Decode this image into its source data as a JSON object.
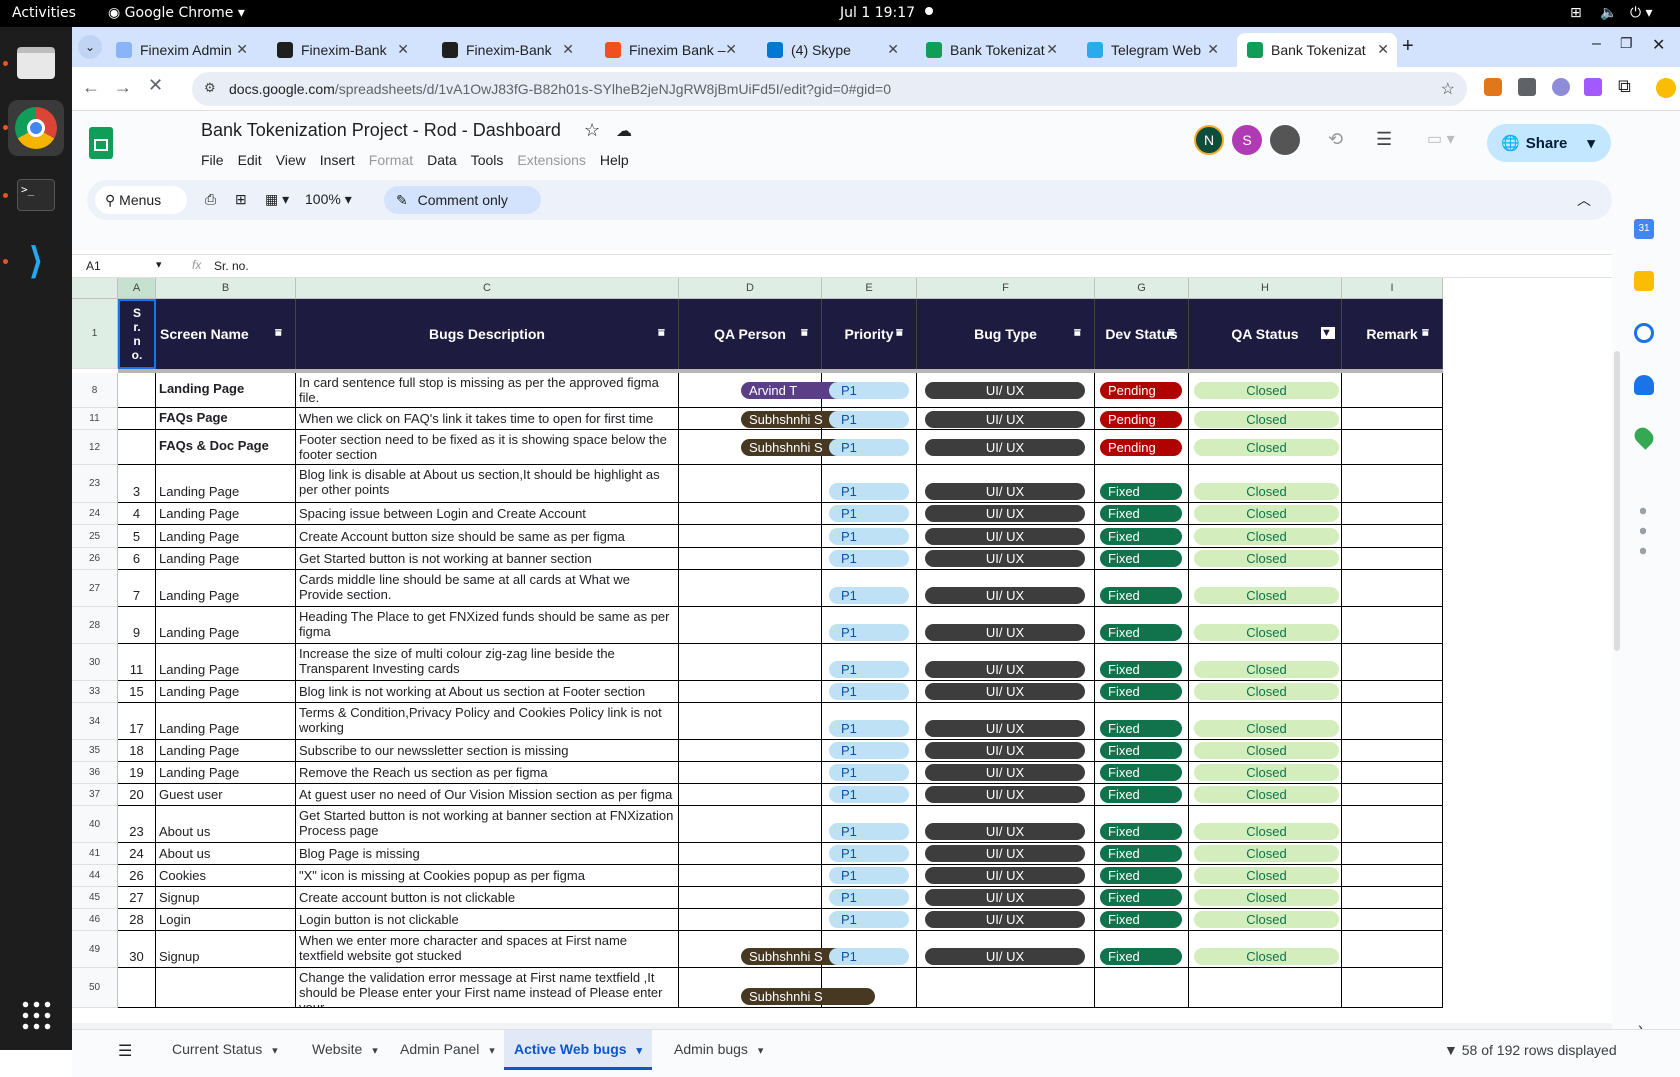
{
  "system": {
    "activities": "Activities",
    "app": "Google Chrome",
    "clock": "Jul 1  19:17"
  },
  "browser": {
    "tabs": [
      {
        "label": "Finexim Admin",
        "color": "#8ab4f8"
      },
      {
        "label": "Finexim-Bank",
        "color": "#1f1f1f"
      },
      {
        "label": "Finexim-Bank",
        "color": "#1f1f1f"
      },
      {
        "label": "Finexim Bank –",
        "color": "#f24e1e"
      },
      {
        "label": "(4) Skype",
        "color": "#0078d4"
      },
      {
        "label": "Bank Tokenizat",
        "color": "#0f9d58"
      },
      {
        "label": "Telegram Web",
        "color": "#2aabee"
      },
      {
        "label": "Bank Tokenizat",
        "color": "#0f9d58"
      }
    ],
    "url_host": "docs.google.com",
    "url_path": "/spreadsheets/d/1vA1OwJ83fG-B82h01s-SYlheB2jeNJgRW8jBmUiFd5I/edit?gid=0#gid=0"
  },
  "doc": {
    "title": "Bank Tokenization Project - Rod - Dashboard",
    "menus": [
      "File",
      "Edit",
      "View",
      "Insert",
      "Format",
      "Data",
      "Tools",
      "Extensions",
      "Help"
    ],
    "share_label": "Share",
    "avatars": [
      "N",
      "S"
    ],
    "search_label": "Menus",
    "zoom": "100%",
    "comment_only": "Comment only",
    "cell_ref": "A1",
    "formula": "Sr. no."
  },
  "columns": [
    "A",
    "B",
    "C",
    "D",
    "E",
    "F",
    "G",
    "H",
    "I"
  ],
  "headers": [
    "Sr. no.",
    "Screen Name",
    "Bugs Description",
    "QA Person",
    "Priority",
    "Bug Type",
    "Dev Status",
    "QA Status",
    "Remark"
  ],
  "rows": [
    {
      "r": "8",
      "sr": "",
      "screen": "Landing Page",
      "desc": "In card sentence full stop is missing as per the approved figma file.",
      "qa": "Arvind T",
      "qacolor": "#5b3f86",
      "pri": "P1",
      "type": "UI/ UX",
      "dev": "Pending",
      "qas": "Closed"
    },
    {
      "r": "11",
      "sr": "",
      "screen": "FAQs Page",
      "desc": "When we click on FAQ's link it takes time to open for first time",
      "qa": "Subhshnhi S",
      "qacolor": "#473822",
      "pri": "P1",
      "type": "UI/ UX",
      "dev": "Pending",
      "qas": "Closed"
    },
    {
      "r": "12",
      "sr": "",
      "screen": "FAQs & Doc Page",
      "desc": "Footer section need to be fixed as it is showing space below the footer section",
      "qa": "Subhshnhi S",
      "qacolor": "#473822",
      "pri": "P1",
      "type": "UI/ UX",
      "dev": "Pending",
      "qas": "Closed"
    },
    {
      "r": "23",
      "sr": "3",
      "screen": "Landing Page",
      "desc": "Blog link is disable at About us section,It should be highlight as per other points",
      "qa": "",
      "qacolor": "",
      "pri": "P1",
      "type": "UI/ UX",
      "dev": "Fixed",
      "qas": "Closed"
    },
    {
      "r": "24",
      "sr": "4",
      "screen": "Landing Page",
      "desc": "Spacing issue between Login and Create Account",
      "qa": "",
      "qacolor": "",
      "pri": "P1",
      "type": "UI/ UX",
      "dev": "Fixed",
      "qas": "Closed"
    },
    {
      "r": "25",
      "sr": "5",
      "screen": "Landing Page",
      "desc": "Create Account button size should be same as per figma",
      "qa": "",
      "qacolor": "",
      "pri": "P1",
      "type": "UI/ UX",
      "dev": "Fixed",
      "qas": "Closed"
    },
    {
      "r": "26",
      "sr": "6",
      "screen": "Landing Page",
      "desc": "Get Started button is not working at banner section",
      "qa": "",
      "qacolor": "",
      "pri": "P1",
      "type": "UI/ UX",
      "dev": "Fixed",
      "qas": "Closed"
    },
    {
      "r": "27",
      "sr": "7",
      "screen": "Landing Page",
      "desc": "Cards middle line should be same at all cards at What we Provide section.",
      "qa": "",
      "qacolor": "",
      "pri": "P1",
      "type": "UI/ UX",
      "dev": "Fixed",
      "qas": "Closed"
    },
    {
      "r": "28",
      "sr": "9",
      "screen": "Landing Page",
      "desc": "Heading The Place to get FNXized funds should be same as per figma",
      "qa": "",
      "qacolor": "",
      "pri": "P1",
      "type": "UI/ UX",
      "dev": "Fixed",
      "qas": "Closed"
    },
    {
      "r": "30",
      "sr": "11",
      "screen": "Landing Page",
      "desc": "Increase the size of multi colour zig-zag line beside the Transparent Investing cards",
      "qa": "",
      "qacolor": "",
      "pri": "P1",
      "type": "UI/ UX",
      "dev": "Fixed",
      "qas": "Closed"
    },
    {
      "r": "33",
      "sr": "15",
      "screen": "Landing Page",
      "desc": "Blog link is not working at About us section at Footer section",
      "qa": "",
      "qacolor": "",
      "pri": "P1",
      "type": "UI/ UX",
      "dev": "Fixed",
      "qas": "Closed"
    },
    {
      "r": "34",
      "sr": "17",
      "screen": "Landing Page",
      "desc": "Terms & Condition,Privacy Policy and Cookies Policy link is not working",
      "qa": "",
      "qacolor": "",
      "pri": "P1",
      "type": "UI/ UX",
      "dev": "Fixed",
      "qas": "Closed"
    },
    {
      "r": "35",
      "sr": "18",
      "screen": "Landing Page",
      "desc": "Subscribe to our newssletter section is missing",
      "qa": "",
      "qacolor": "",
      "pri": "P1",
      "type": "UI/ UX",
      "dev": "Fixed",
      "qas": "Closed"
    },
    {
      "r": "36",
      "sr": "19",
      "screen": "Landing Page",
      "desc": "Remove the Reach us section as per figma",
      "qa": "",
      "qacolor": "",
      "pri": "P1",
      "type": "UI/ UX",
      "dev": "Fixed",
      "qas": "Closed"
    },
    {
      "r": "37",
      "sr": "20",
      "screen": "Guest user",
      "desc": "At guest user no need of Our Vision Mission section as per figma",
      "qa": "",
      "qacolor": "",
      "pri": "P1",
      "type": "UI/ UX",
      "dev": "Fixed",
      "qas": "Closed"
    },
    {
      "r": "40",
      "sr": "23",
      "screen": "About us",
      "desc": "Get Started button is not working at banner section at FNXization Process page",
      "qa": "",
      "qacolor": "",
      "pri": "P1",
      "type": "UI/ UX",
      "dev": "Fixed",
      "qas": "Closed"
    },
    {
      "r": "41",
      "sr": "24",
      "screen": "About us",
      "desc": "Blog Page is missing",
      "qa": "",
      "qacolor": "",
      "pri": "P1",
      "type": "UI/ UX",
      "dev": "Fixed",
      "qas": "Closed"
    },
    {
      "r": "44",
      "sr": "26",
      "screen": "Cookies",
      "desc": "\"X\" icon is missing at Cookies popup as per figma",
      "qa": "",
      "qacolor": "",
      "pri": "P1",
      "type": "UI/ UX",
      "dev": "Fixed",
      "qas": "Closed"
    },
    {
      "r": "45",
      "sr": "27",
      "screen": "Signup",
      "desc": "Create account button is not clickable",
      "qa": "",
      "qacolor": "",
      "pri": "P1",
      "type": "UI/ UX",
      "dev": "Fixed",
      "qas": "Closed"
    },
    {
      "r": "46",
      "sr": "28",
      "screen": "Login",
      "desc": "Login button is not clickable",
      "qa": "",
      "qacolor": "",
      "pri": "P1",
      "type": "UI/ UX",
      "dev": "Fixed",
      "qas": "Closed"
    },
    {
      "r": "49",
      "sr": "30",
      "screen": "Signup",
      "desc": "When we enter more character and spaces at First name textfield website got stucked",
      "qa": "Subhshnhi S",
      "qacolor": "#473822",
      "pri": "P1",
      "type": "UI/ UX",
      "dev": "Fixed",
      "qas": "Closed"
    },
    {
      "r": "50",
      "sr": "",
      "screen": "",
      "desc": "Change the validation error message at First name textfield ,It should be Please enter your First name instead of Please enter your",
      "qa": "Subhshnhi S",
      "qacolor": "#473822",
      "pri": "",
      "type": "",
      "dev": "",
      "qas": ""
    }
  ],
  "sheet_tabs": [
    "Current Status",
    "Website",
    "Admin Panel",
    "Active Web bugs",
    "Admin bugs"
  ],
  "rows_displayed": "58 of 192 rows displayed"
}
